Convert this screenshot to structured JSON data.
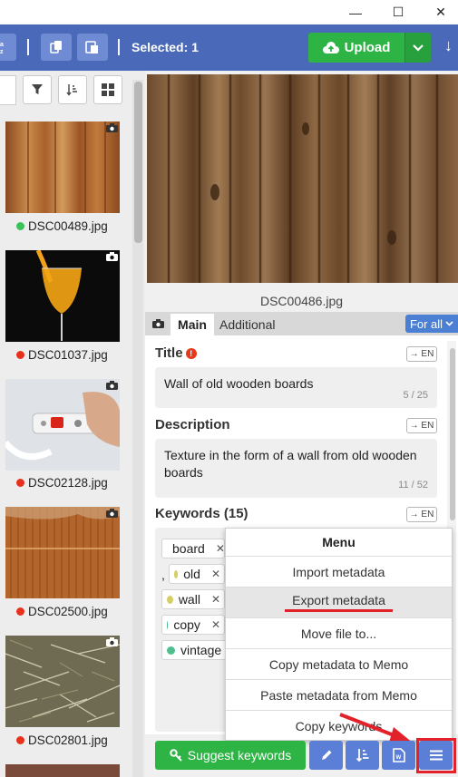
{
  "window": {
    "minimize": "—",
    "maximize": "☐",
    "close": "✕"
  },
  "toolbar": {
    "selected_text": "Selected: 1",
    "upload_label": "Upload",
    "colors": {
      "bar": "#4a69b8",
      "upload": "#2db445"
    }
  },
  "gallery": {
    "items": [
      {
        "name": "DSC00489.jpg",
        "status": "green"
      },
      {
        "name": "DSC01037.jpg",
        "status": "red"
      },
      {
        "name": "DSC02128.jpg",
        "status": "red"
      },
      {
        "name": "DSC02500.jpg",
        "status": "red"
      },
      {
        "name": "DSC02801.jpg",
        "status": "red"
      }
    ]
  },
  "preview": {
    "filename": "DSC00486.jpg"
  },
  "tabs": {
    "main": "Main",
    "additional": "Additional",
    "for_all": "For all"
  },
  "form": {
    "title_label": "Title",
    "title_value": "Wall of old wooden boards",
    "title_count": "5 / 25",
    "desc_label": "Description",
    "desc_value": "Texture in the form of a wall from old wooden boards",
    "desc_count": "11 / 52",
    "keywords_label": "Keywords (15)",
    "lang_button": "→ EN",
    "keywords": [
      {
        "text": "board",
        "color": "#d4cf63"
      },
      {
        "text": "old",
        "color": "#d4cf63"
      },
      {
        "text": "wall",
        "color": "#d4cf63"
      },
      {
        "text": "copy",
        "color": "#4fc08d"
      },
      {
        "text": "vintage",
        "color": "#4fc08d"
      }
    ],
    "separator": ","
  },
  "menu": {
    "title": "Menu",
    "items": [
      "Import metadata",
      "Export metadata",
      "Move file to...",
      "Copy metadata to Memo",
      "Paste metadata from Memo",
      "Copy keywords"
    ]
  },
  "bottom": {
    "suggest_label": "Suggest keywords"
  }
}
